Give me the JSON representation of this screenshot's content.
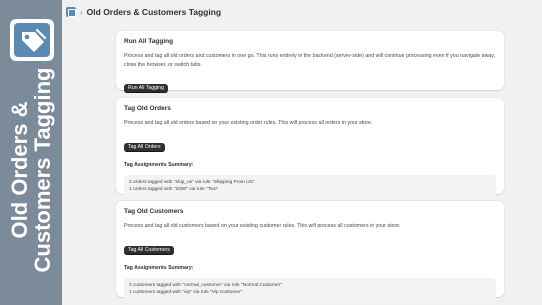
{
  "promo": {
    "title_line1": "Old Orders &",
    "title_line2": "Customers Tagging"
  },
  "header": {
    "separator": "›",
    "title": "Old Orders & Customers Tagging"
  },
  "run_all": {
    "title": "Run All Tagging",
    "description": "Process and tag all old orders and customers in one go. This runs entirely in the backend (server-side) and will continue processing even if you navigate away, close the browser, or switch tabs.",
    "button": "Run All Tagging"
  },
  "orders": {
    "title": "Tag Old Orders",
    "description": "Process and tag all old orders based on your existing order rules. This will process all orders in your store.",
    "button": "Tag All Orders",
    "summary_title": "Tag Assignments Summary:",
    "summary": [
      "2 orders tagged with \"ship_us\" via rule \"Shipping From US\"",
      "1 orders tagged with \"2000\" via rule \"Two\""
    ]
  },
  "customers": {
    "title": "Tag Old Customers",
    "description": "Process and tag all old customers based on your existing customer rules. This will process all customers in your store.",
    "button": "Tag All Customers",
    "summary_title": "Tag Assignments Summary:",
    "summary": [
      "3 customers tagged with \"normal_customer\" via rule \"Normal Customer\"",
      "1 customers tagged with \"vip\" via rule \"Vip Customer\""
    ]
  },
  "colors": {
    "promo_bg": "#7b8b99",
    "button_bg": "#303030",
    "page_bg": "#f1f1f1"
  }
}
